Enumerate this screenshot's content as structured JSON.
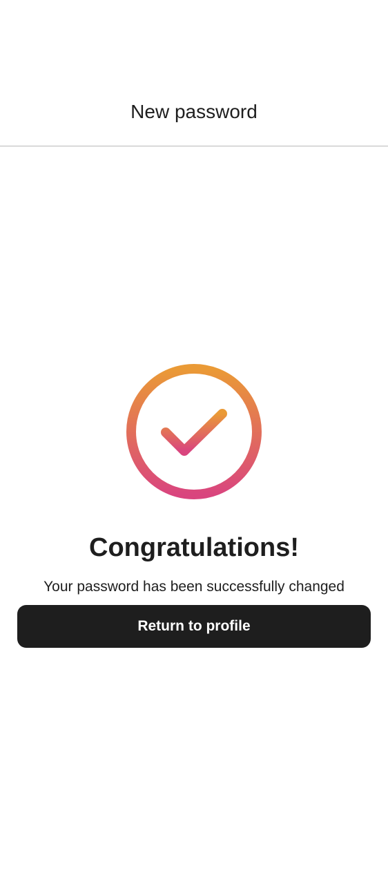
{
  "header": {
    "title": "New password"
  },
  "success": {
    "icon": "check-circle-icon",
    "gradient_top": "#EA9A36",
    "gradient_bottom": "#D9457E",
    "headline": "Congratulations!",
    "message": "Your password has been successfully changed"
  },
  "actions": {
    "return_label": "Return to profile",
    "button_color": "#1E1E1E"
  }
}
